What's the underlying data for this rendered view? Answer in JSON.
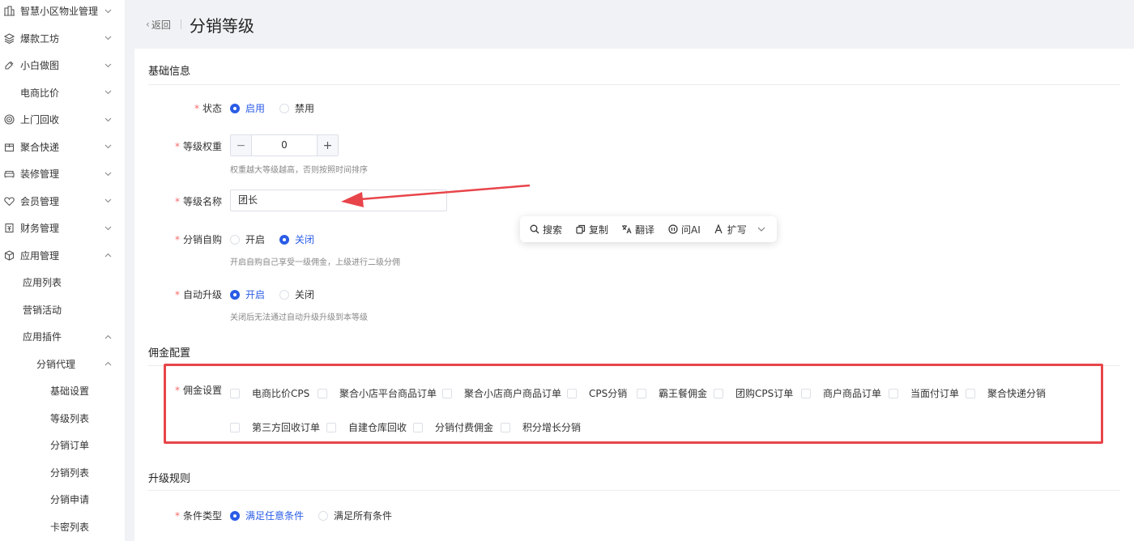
{
  "sidebar": {
    "items": [
      {
        "label": "智慧小区物业管理",
        "icon": "building-icon",
        "expanded": false
      },
      {
        "label": "爆款工坊",
        "icon": "layers-icon",
        "expanded": false
      },
      {
        "label": "小白做图",
        "icon": "image-edit-icon",
        "expanded": false
      },
      {
        "label": "电商比价",
        "icon": "",
        "expanded": false
      },
      {
        "label": "上门回收",
        "icon": "target-icon",
        "expanded": false
      },
      {
        "label": "聚合快递",
        "icon": "package-icon",
        "expanded": false
      },
      {
        "label": "装修管理",
        "icon": "sofa-icon",
        "expanded": false
      },
      {
        "label": "会员管理",
        "icon": "heart-icon",
        "expanded": false
      },
      {
        "label": "财务管理",
        "icon": "finance-icon",
        "expanded": false
      },
      {
        "label": "应用管理",
        "icon": "cube-icon",
        "expanded": true
      }
    ],
    "app_sub": [
      {
        "label": "应用列表"
      },
      {
        "label": "营销活动"
      },
      {
        "label": "应用插件",
        "expanded": true
      }
    ],
    "plugin_sub": [
      {
        "label": "分销代理",
        "expanded": true
      }
    ],
    "dist_sub": [
      {
        "label": "基础设置"
      },
      {
        "label": "等级列表"
      },
      {
        "label": "分销订单"
      },
      {
        "label": "分销列表"
      },
      {
        "label": "分销申请"
      },
      {
        "label": "卡密列表"
      }
    ]
  },
  "header": {
    "back_label": "返回",
    "title": "分销等级"
  },
  "basic": {
    "section_title": "基础信息",
    "status": {
      "label": "状态",
      "options": [
        "启用",
        "禁用"
      ],
      "selected": "启用"
    },
    "weight": {
      "label": "等级权重",
      "value": "0",
      "minus": "−",
      "plus": "+",
      "hint": "权重越大等级越高，否则按照时间排序"
    },
    "name": {
      "label": "等级名称",
      "value": "团长"
    },
    "self_purchase": {
      "label": "分销自购",
      "options": [
        "开启",
        "关闭"
      ],
      "selected": "关闭",
      "hint": "开启自购自己享受一级佣金，上级进行二级分佣"
    },
    "auto_upgrade": {
      "label": "自动升级",
      "options": [
        "开启",
        "关闭"
      ],
      "selected": "开启",
      "hint": "关闭后无法通过自动升级升级到本等级"
    }
  },
  "commission": {
    "section_title": "佣金配置",
    "label": "佣金设置",
    "options_row1": [
      "电商比价CPS",
      "聚合小店平台商品订单",
      "聚合小店商户商品订单",
      "CPS分销",
      "霸王餐佣金",
      "团购CPS订单",
      "商户商品订单",
      "当面付订单",
      "聚合快递分销"
    ],
    "options_row2": [
      "第三方回收订单",
      "自建仓库回收",
      "分销付费佣金",
      "积分增长分销"
    ]
  },
  "upgrade": {
    "section_title": "升级规则",
    "condition": {
      "label": "条件类型",
      "options": [
        "满足任意条件",
        "满足所有条件"
      ],
      "selected": "满足任意条件"
    }
  },
  "toolbar": {
    "items": [
      {
        "label": "搜索",
        "icon": "search-icon"
      },
      {
        "label": "复制",
        "icon": "copy-icon"
      },
      {
        "label": "翻译",
        "icon": "translate-icon"
      },
      {
        "label": "问AI",
        "icon": "ai-icon"
      },
      {
        "label": "扩写",
        "icon": "expand-write-icon"
      }
    ]
  },
  "colors": {
    "primary": "#2b5ce6",
    "required": "#f56c6c",
    "highlight_box": "#e8454a"
  }
}
